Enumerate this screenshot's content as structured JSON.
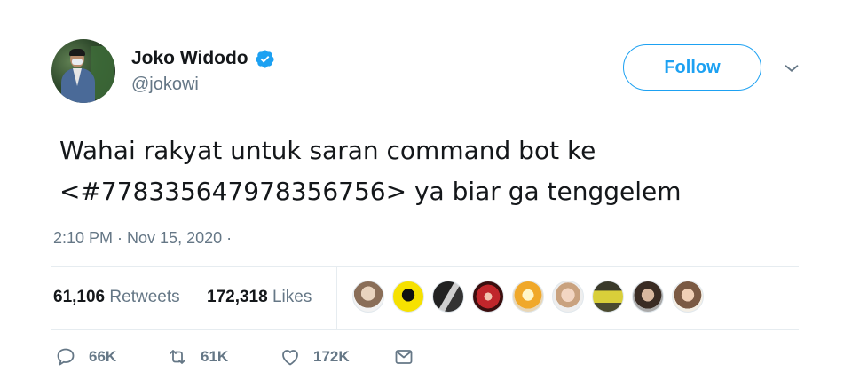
{
  "user": {
    "name": "Joko Widodo",
    "handle": "@jokowi"
  },
  "follow_label": "Follow",
  "tweet": {
    "line1": "Wahai rakyat untuk saran command bot ke",
    "line2": "<#778335647978356756> ya biar ga tenggelem"
  },
  "timestamp": "2:10 PM · Nov 15, 2020 ·",
  "stats": {
    "retweets_count": "61,106",
    "retweets_label": "Retweets",
    "likes_count": "172,318",
    "likes_label": "Likes"
  },
  "liker_avatars": [
    "liker-avatar-1",
    "liker-avatar-2",
    "liker-avatar-3",
    "liker-avatar-4",
    "liker-avatar-5",
    "liker-avatar-6",
    "liker-avatar-7",
    "liker-avatar-8",
    "liker-avatar-9"
  ],
  "actions": {
    "reply_count": "66K",
    "retweet_count": "61K",
    "like_count": "172K"
  },
  "colors": {
    "accent": "#1da1f2",
    "text": "#14171a",
    "muted": "#657786",
    "divider": "#e6ecf0"
  },
  "icons": [
    "verified-badge-icon",
    "chevron-down-icon",
    "reply-icon",
    "retweet-icon",
    "like-icon",
    "share-icon"
  ]
}
